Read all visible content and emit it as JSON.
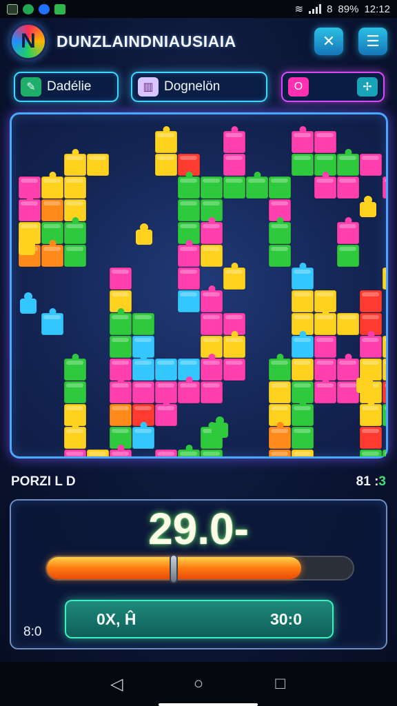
{
  "status_bar": {
    "battery": "89%",
    "time": "12:12",
    "battery_glyph": "8"
  },
  "header": {
    "title": "DUNZLAINDNIAUSIAIA",
    "logo_glyph": "N",
    "btn1_icon": "crossed-arrows-icon",
    "btn1_glyph": "✕",
    "btn2_icon": "menu-icon",
    "btn2_glyph": "☰"
  },
  "controls": {
    "c1_label": "Dadélie",
    "c1_icon": "brush-icon",
    "c1_glyph": "✎",
    "c2_label": "Dognelön",
    "c2_icon": "chart-icon",
    "c2_glyph": "▥",
    "c3_icon_left": "piece-icon",
    "c3_glyph_left": "O",
    "c3_icon_right": "move-icon",
    "c3_glyph_right": "✢"
  },
  "board": {
    "colors": {
      "pink": "#ff3fae",
      "green": "#2fc93e",
      "yellow": "#ffd21f",
      "orange": "#ff8a1a",
      "red": "#ff3b2f",
      "cyan": "#33c6ff",
      "magenta": "#f03ce8"
    }
  },
  "progress": {
    "label": "PORZI L D",
    "count_prefix": "81 :",
    "count_suffix": "3",
    "score": "29.0-",
    "fill_fraction": 0.83,
    "corner_text": "8:0",
    "button_left": "0X, Ĥ",
    "button_right": "30:0"
  },
  "nav": {
    "back_glyph": "◁",
    "home_glyph": "○",
    "recents_glyph": "□"
  }
}
